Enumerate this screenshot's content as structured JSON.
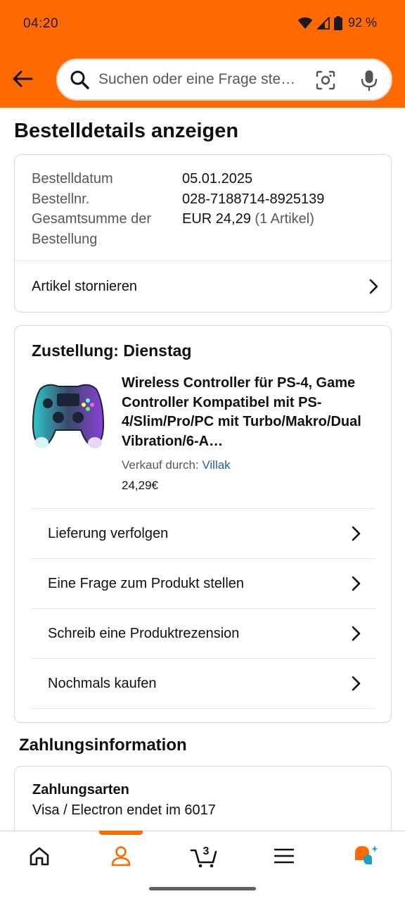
{
  "status_bar": {
    "time": "04:20",
    "battery": "92 %",
    "icons": [
      "wifi-icon",
      "signal-icon",
      "battery-icon"
    ]
  },
  "header": {
    "search_placeholder": "Suchen oder eine Frage ste…",
    "accent_color": "#ff6a00"
  },
  "page": {
    "title": "Bestelldetails anzeigen"
  },
  "order_summary": {
    "rows": [
      {
        "label": "Bestelldatum",
        "value": "05.01.2025"
      },
      {
        "label": "Bestellnr.",
        "value": "028-7188714-8925139"
      },
      {
        "label": "Gesamtsumme der Bestellung",
        "value": "EUR 24,29",
        "extra": "(1 Artikel)"
      }
    ],
    "cancel_label": "Artikel stornieren"
  },
  "delivery": {
    "heading": "Zustellung: Dienstag",
    "product_title": "Wireless Controller für PS-4, Game Controller Kompatibel mit PS-4/Slim/Pro/PC mit Turbo/Makro/Dual Vibration/6-A…",
    "seller_prefix": "Verkauf durch:",
    "seller_name": "Villak",
    "price": "24,29€",
    "actions": [
      "Lieferung verfolgen",
      "Eine Frage zum Produkt stellen",
      "Schreib eine Produktrezension",
      "Nochmals kaufen"
    ]
  },
  "payment": {
    "section_title": "Zahlungsinformation",
    "label": "Zahlungsarten",
    "value": "Visa / Electron  endet im 6017"
  },
  "bottom_nav": {
    "items": [
      "home-icon",
      "account-icon",
      "cart-icon",
      "menu-icon",
      "rufus-icon"
    ],
    "active": "account-icon",
    "cart_count": "3"
  }
}
